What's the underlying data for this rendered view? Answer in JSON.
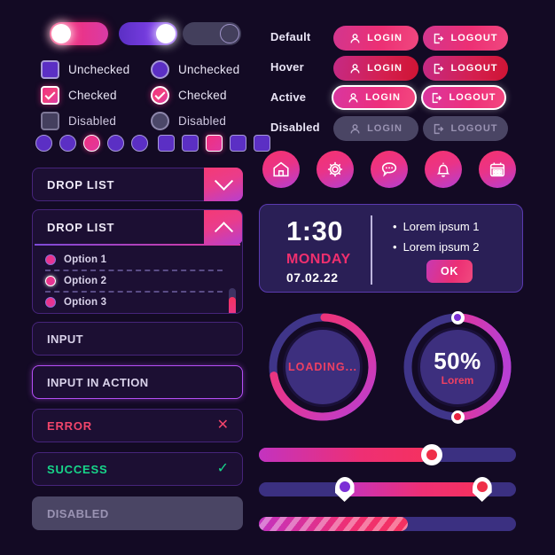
{
  "theme": {
    "background": "#130a24",
    "accent_pink": "#ee2f74",
    "accent_purple": "#5b2fc4",
    "error": "#f2456b",
    "success": "#17d68a",
    "disabled": "#4a4564"
  },
  "toggles": [
    {
      "name": "toggle-on-pink",
      "state": "on",
      "knob": "left"
    },
    {
      "name": "toggle-on-purple",
      "state": "on",
      "knob": "right"
    },
    {
      "name": "toggle-disabled",
      "state": "disabled",
      "knob": "right"
    }
  ],
  "checkboxes": [
    {
      "label": "Unchecked",
      "state": "unchecked"
    },
    {
      "label": "Checked",
      "state": "checked"
    },
    {
      "label": "Disabled",
      "state": "disabled"
    }
  ],
  "radios": [
    {
      "label": "Unchecked",
      "state": "unchecked"
    },
    {
      "label": "Checked",
      "state": "checked"
    },
    {
      "label": "Disabled",
      "state": "disabled"
    }
  ],
  "indicator_dots": {
    "count": 5,
    "selected_index": 2
  },
  "indicator_boxes": {
    "count": 5,
    "selected_index": 2
  },
  "dropdown_closed": {
    "label": "DROP LIST",
    "icon": "chevron-down-icon"
  },
  "dropdown_open": {
    "label": "DROP LIST",
    "icon": "chevron-up-icon",
    "options": [
      {
        "label": "Option 1",
        "focused": false
      },
      {
        "label": "Option 2",
        "focused": true
      },
      {
        "label": "Option 3",
        "focused": false
      }
    ],
    "scrollbar": {
      "visible": true
    }
  },
  "inputs": [
    {
      "name": "input-default",
      "value": "INPUT",
      "state": "default",
      "icon": null
    },
    {
      "name": "input-active",
      "value": "INPUT IN ACTION",
      "state": "active",
      "icon": null
    },
    {
      "name": "input-error",
      "value": "ERROR",
      "state": "error",
      "icon": "close-icon",
      "icon_glyph": "✕"
    },
    {
      "name": "input-success",
      "value": "SUCCESS",
      "state": "success",
      "icon": "check-icon",
      "icon_glyph": "✓"
    },
    {
      "name": "input-disabled",
      "value": "DISABLED",
      "state": "disabled",
      "icon": null
    }
  ],
  "button_matrix": {
    "row_labels": [
      "Default",
      "Hover",
      "Active",
      "Disabled"
    ],
    "columns": [
      {
        "label": "LOGIN",
        "icon": "user-icon"
      },
      {
        "label": "LOGOUT",
        "icon": "logout-icon"
      }
    ]
  },
  "icon_buttons": [
    {
      "name": "home-icon",
      "label": "home"
    },
    {
      "name": "gear-icon",
      "label": "settings"
    },
    {
      "name": "chat-icon",
      "label": "messages"
    },
    {
      "name": "bell-icon",
      "label": "notifications"
    },
    {
      "name": "calendar-icon",
      "label": "calendar"
    }
  ],
  "alarm_card": {
    "time": "1:30",
    "day": "MONDAY",
    "date": "07.02.22",
    "bullets": [
      "Lorem ipsum 1",
      "Lorem ipsum 2"
    ],
    "ok_label": "OK"
  },
  "progress_circles": [
    {
      "name": "loading-spinner",
      "text": "LOADING...",
      "percent": 72,
      "handles": false
    },
    {
      "name": "percent-dial",
      "text": "50%",
      "subtext": "Lorem",
      "percent": 50,
      "handles": true
    }
  ],
  "sliders": [
    {
      "name": "slider-single",
      "type": "single",
      "value": 66
    },
    {
      "name": "slider-range",
      "type": "range",
      "from": 32,
      "to": 85
    },
    {
      "name": "progress-striped",
      "type": "progress",
      "value": 58
    }
  ]
}
